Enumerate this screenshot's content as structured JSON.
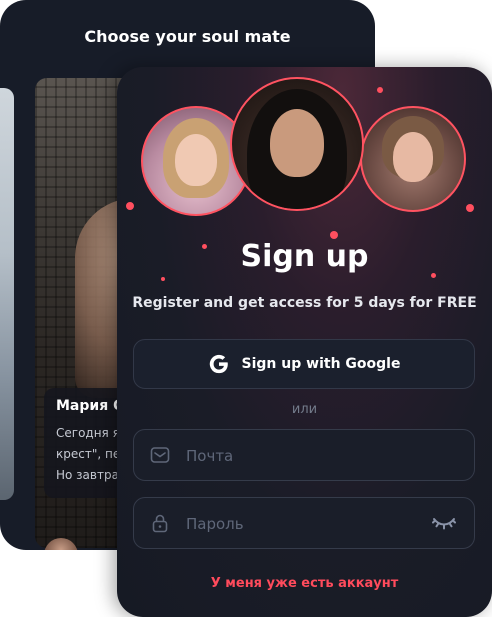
{
  "back_card": {
    "title": "Choose your soul mate",
    "profile": {
      "name": "Мария О",
      "text_lines": [
        "Сегодня я",
        "крест\", пе",
        "Но завтра"
      ]
    }
  },
  "signup": {
    "title": "Sign up",
    "subtitle": "Register and get access for 5 days for FREE",
    "google_label": "Sign up with Google",
    "or_text": "или",
    "email_placeholder": "Почта",
    "password_placeholder": "Пароль",
    "login_link": "У меня уже есть аккаунт"
  },
  "colors": {
    "accent": "#ff4f5f",
    "background": "#171c28",
    "input_border": "#353b4a"
  },
  "icons": [
    "google-icon",
    "mail-icon",
    "lock-icon",
    "eye-closed-icon"
  ]
}
